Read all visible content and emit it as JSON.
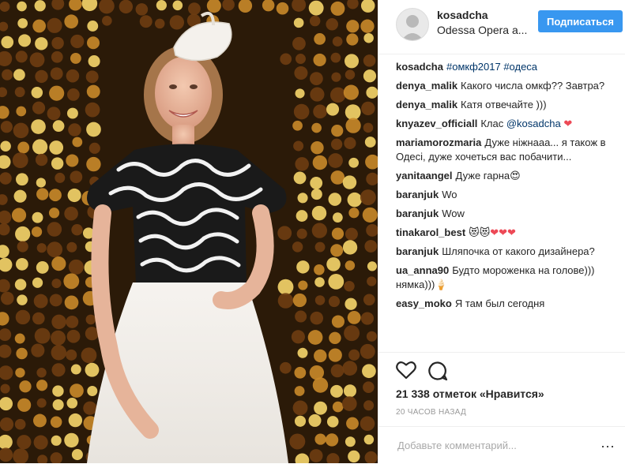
{
  "post": {
    "username": "kosadcha",
    "location": "Odessa Opera a...",
    "follow_label": "Подписаться"
  },
  "comments": [
    {
      "user": "kosadcha",
      "parts": [
        {
          "type": "hash",
          "text": "#омкф2017"
        },
        {
          "type": "text",
          "text": " "
        },
        {
          "type": "hash",
          "text": "#одеса"
        }
      ]
    },
    {
      "user": "denya_malik",
      "parts": [
        {
          "type": "text",
          "text": "Какого числа омкф?? Завтра?"
        }
      ]
    },
    {
      "user": "denya_malik",
      "parts": [
        {
          "type": "text",
          "text": "Катя отвечайте )))"
        }
      ]
    },
    {
      "user": "knyazev_officiall",
      "parts": [
        {
          "type": "text",
          "text": "Клас "
        },
        {
          "type": "mention",
          "text": "@kosadcha"
        },
        {
          "type": "text",
          "text": " "
        },
        {
          "type": "heart",
          "text": "❤"
        }
      ]
    },
    {
      "user": "mariamorozmaria",
      "parts": [
        {
          "type": "text",
          "text": "Дуже ніжнааа... я також в Одесі, дуже хочеться вас побачити..."
        }
      ]
    },
    {
      "user": "yanitaangel",
      "parts": [
        {
          "type": "text",
          "text": "Дуже гарна😍"
        }
      ]
    },
    {
      "user": "baranjuk",
      "parts": [
        {
          "type": "text",
          "text": "Wo"
        }
      ]
    },
    {
      "user": "baranjuk",
      "parts": [
        {
          "type": "text",
          "text": "Wow"
        }
      ]
    },
    {
      "user": "tinakarol_best",
      "parts": [
        {
          "type": "text",
          "text": "😻😻"
        },
        {
          "type": "heart",
          "text": "❤❤❤"
        }
      ]
    },
    {
      "user": "baranjuk",
      "parts": [
        {
          "type": "text",
          "text": "Шляпочка от какого дизайнера?"
        }
      ]
    },
    {
      "user": "ua_anna90",
      "parts": [
        {
          "type": "text",
          "text": "Будто мороженка на голове))) нямка)))🍦"
        }
      ]
    },
    {
      "user": "easy_moko",
      "parts": [
        {
          "type": "text",
          "text": "Я там был сегодня"
        }
      ]
    }
  ],
  "actions": {
    "likes_text": "21 338 отметок «Нравится»",
    "time_text": "20 ЧАСОВ НАЗАД",
    "comment_placeholder": "Добавьте комментарий...",
    "more_label": "···"
  },
  "colors": {
    "accent": "#3897f0",
    "hashtag": "#003569",
    "heart": "#ed4956"
  }
}
